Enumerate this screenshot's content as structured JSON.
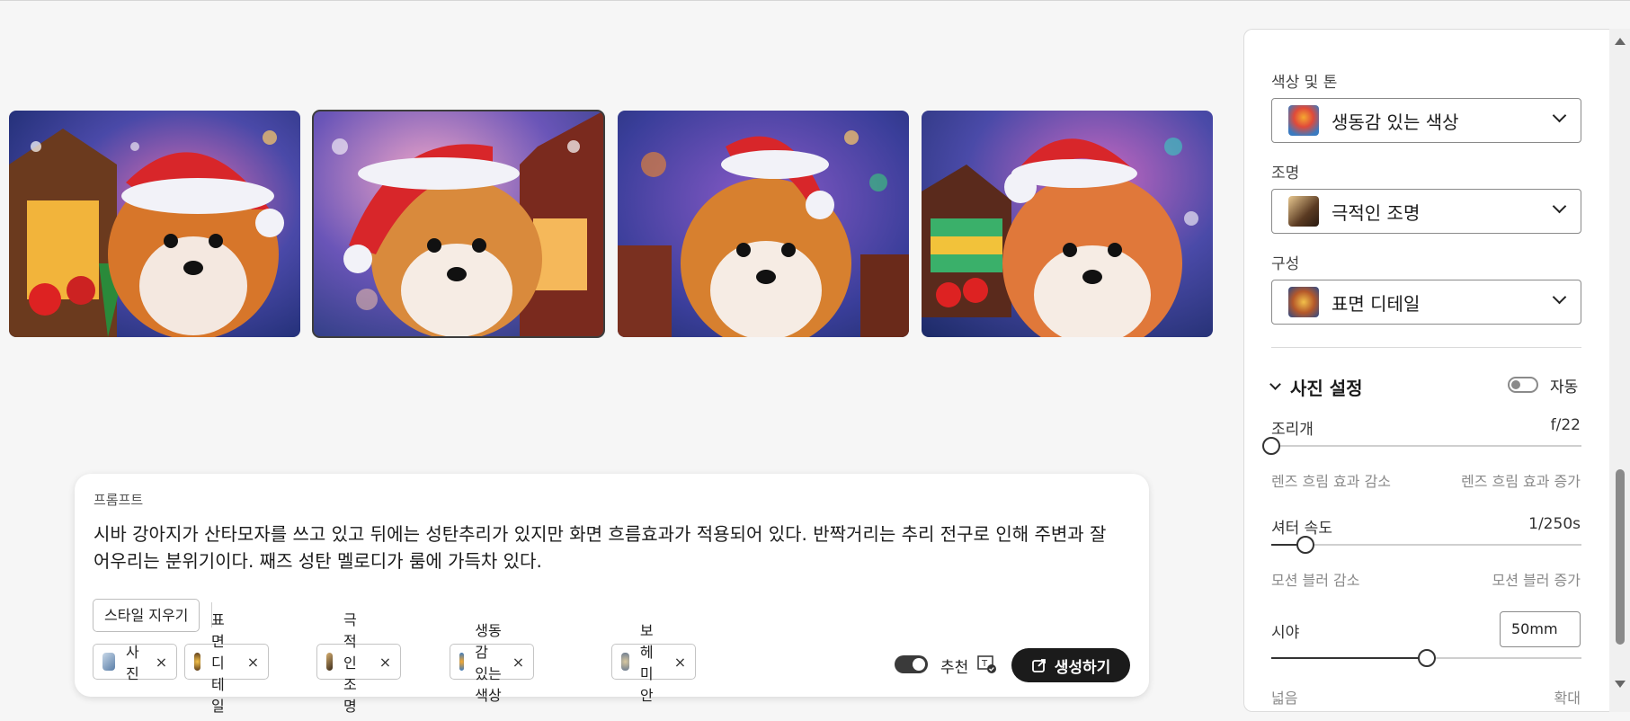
{
  "gallery": {
    "images": [
      {
        "alt": "shiba-santa-1"
      },
      {
        "alt": "shiba-santa-2"
      },
      {
        "alt": "shiba-santa-3"
      },
      {
        "alt": "shiba-santa-4"
      }
    ]
  },
  "prompt": {
    "label": "프롬프트",
    "text": "시바 강아지가 산타모자를 쓰고 있고 뒤에는 성탄추리가 있지만 화면 흐름효과가 적용되어 있다. 반짝거리는 추리 전구로 인해 주변과 잘 어우리는 분위기이다. 째즈 성탄 멜로디가 룸에 가득차 있다.",
    "clear_style": "스타일 지우기",
    "chips": [
      {
        "label": "사진",
        "remove": "×",
        "color": "#7a9fc0"
      },
      {
        "label": "표면 디테일",
        "remove": "×",
        "color": "#b5832c"
      },
      {
        "label": "극적인 조명",
        "remove": "×",
        "color": "#6b5a44"
      },
      {
        "label": "생동감 있는 색상",
        "remove": "×",
        "color": "#e29a2d"
      },
      {
        "label": "보헤미안",
        "remove": "×",
        "color": "#9aa4b0"
      }
    ],
    "recommend_label": "추천",
    "t_icon": "T",
    "generate_label": "생성하기"
  },
  "panel": {
    "color_tone_label": "색상 및 톤",
    "color_tone_value": "생동감 있는 색상",
    "lighting_label": "조명",
    "lighting_value": "극적인 조명",
    "composition_label": "구성",
    "composition_value": "표면 디테일",
    "photo_settings_title": "사진 설정",
    "auto_label": "자동",
    "aperture": {
      "label": "조리개",
      "value": "f/22",
      "level": 0.0,
      "hint_left": "렌즈 흐림 효과 감소",
      "hint_right": "렌즈 흐림 효과 증가"
    },
    "shutter": {
      "label": "셔터 속도",
      "value": "1/250s",
      "level": 0.11,
      "hint_left": "모션 블러 감소",
      "hint_right": "모션 블러 증가"
    },
    "fov": {
      "label": "시야",
      "value": "50mm",
      "level": 0.5,
      "hint_left": "넓음",
      "hint_right": "확대"
    }
  },
  "colors": {
    "accent": "#1b1b1b",
    "panel_bg": "#ffffff",
    "page_bg": "#f6f6f6"
  }
}
